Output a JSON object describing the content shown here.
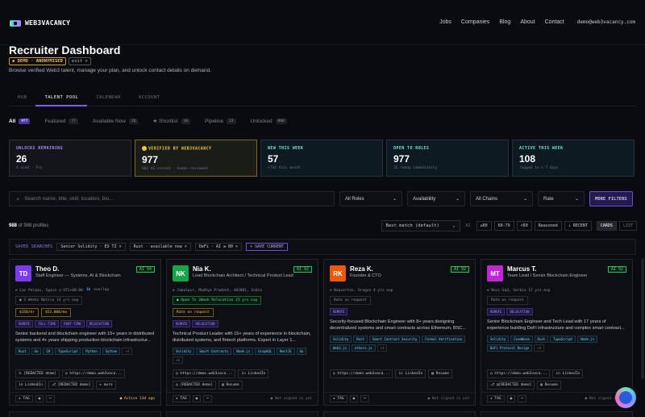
{
  "nav": {
    "brand": "WEB3VACANCY",
    "links": [
      "Jobs",
      "Companies",
      "Blog",
      "About",
      "Contact"
    ],
    "email": "demo@web3vacancy.com"
  },
  "page": {
    "title": "Recruiter Dashboard",
    "demo": "◆ DEMO · ANONYMISED",
    "exit": "exit ×",
    "subtitle": "Browse verified Web3 talent, manage your plan, and unlock contact details on demand."
  },
  "tabs": [
    "HUB",
    "TALENT POOL",
    "CALENDAR",
    "ACCOUNT"
  ],
  "subtabs": [
    {
      "label": "All",
      "count": "977"
    },
    {
      "label": "Featured",
      "count": "77"
    },
    {
      "label": "Available Now",
      "count": "26"
    },
    {
      "label": "★ Shortlist",
      "count": "10"
    },
    {
      "label": "Pipeline",
      "count": "13"
    },
    {
      "label": "Unlocked",
      "count": "000"
    }
  ],
  "stats": [
    {
      "label": "UNLOCKS REMAINING",
      "value": "26",
      "sub": "4 used · Pro"
    },
    {
      "label": "VERIFIED BY WEB3VACANCY",
      "value": "977",
      "sub": "802 AI-scored · human-reviewed"
    },
    {
      "label": "NEW THIS WEEK",
      "value": "57",
      "sub": "+744 this month"
    },
    {
      "label": "OPEN TO ROLES",
      "value": "977",
      "sub": "26 ready immediately"
    },
    {
      "label": "ACTIVE THIS WEEK",
      "value": "108",
      "sub": "logged in < 7 days"
    }
  ],
  "filters": {
    "search_placeholder": "Search name, title, skill, location, bio...",
    "roles": "All Roles",
    "availability": "Availability",
    "chains": "All Chains",
    "rate": "Rate",
    "more": "MORE FILTERS"
  },
  "results": {
    "count": "988",
    "total": "of 988 profiles"
  },
  "sort": {
    "value": "Best match (default)",
    "chips": [
      "AI",
      "≥80",
      "60-79",
      "<60",
      "Reasoned",
      "↓ RECENT"
    ],
    "views": [
      "CARDS",
      "LIST"
    ]
  },
  "saved": {
    "label": "SAVED SEARCHES",
    "chips": [
      "Senior Solidity · EU TZ ×",
      "Rust · available now ×",
      "DeFi · AI ≥ 80 ×"
    ],
    "save": "+ SAVE CURRENT"
  },
  "cards": [
    {
      "initials": "TD",
      "color": "#7c3aed",
      "name": "Theo D.",
      "role": "Staff Engineer — Systems, AI & Blockchain",
      "ai": "AI 94",
      "loc": "⌖ Las Palmas, Spain  ◷ UTC+00:00",
      "overlap": "1h",
      "overlap_text": "overlap",
      "notice": "● 2 Weeks Notice  14 yrs exp",
      "notice_green": false,
      "rates": [
        "$150/hr",
        "$53,000/mo"
      ],
      "badges": [
        "REMOTE",
        "FULL-TIME",
        "PART-TIME",
        "RELOCATION"
      ],
      "bio": "Senior backend and blockchain engineer with 15+ years in distributed systems and 4+ years shipping production blockchain infrastructur...",
      "skills": [
        "Rust",
        "Go",
        "C#",
        "TypeScript",
        "Python",
        "Sython",
        "+4"
      ],
      "links": [
        "𝕏 [REDACTED demo]",
        "◎ https://demo.web3vaca...",
        "in LinkedIn",
        "⎇ [REDACTED demo]",
        "+ more"
      ],
      "foot": [
        "★ TAG",
        "◉",
        "⋯"
      ],
      "status": "● Active 13d ago",
      "active": true
    },
    {
      "initials": "NK",
      "color": "#16a34a",
      "name": "Nia K.",
      "role": "Lead Blockchain Architect / Technical Product Lead",
      "ai": "AI 92",
      "loc": "⌖ Jabalpur, Madhya Pradesh, 482001, India",
      "overlap": "",
      "overlap_text": "",
      "notice": "● Open To 2Week Relocation  23 yrs exp",
      "notice_green": true,
      "rates": [
        "Rate on request"
      ],
      "badges": [
        "REMOTE",
        "RELOCATION"
      ],
      "bio": "Technical Product Leader with 15+ years of experience in blockchain, distributed systems, and fintech platforms. Expert in Layer 1...",
      "skills": [
        "Solidity",
        "Smart Contracts",
        "Node.js",
        "GraphQL",
        "NestJS",
        "Go",
        "+4"
      ],
      "links": [
        "◎ https://demo.web3vaca...",
        "in LinkedIn",
        "◎ [REDACTED demo]",
        "▤ Resume"
      ],
      "foot": [
        "★ TAG",
        "◉",
        "⋯"
      ],
      "status": "● Not signed in yet",
      "active": false
    },
    {
      "initials": "RK",
      "color": "#ea580c",
      "name": "Reza K.",
      "role": "Founder & CTO",
      "ai": "AI 92",
      "loc": "⌖ Beaverton, Oregon  4 yrs exp",
      "overlap": "",
      "overlap_text": "",
      "notice": "Rate on request",
      "notice_green": false,
      "rates": [],
      "badges": [
        "REMOTE"
      ],
      "bio": "Security-focused Blockchain Engineer with 8+ years designing decentralized systems and smart contracts across Ethereum, BSC...",
      "skills": [
        "Solidity",
        "Rust",
        "Smart Contract Security",
        "Formal Verification",
        "Web3.js",
        "ethers.js",
        "+4"
      ],
      "links": [
        "◎ https://demo.web3vaca...",
        "in LinkedIn",
        "▤ Resume"
      ],
      "foot": [
        "★ TAG",
        "◉",
        "⋯"
      ],
      "status": "● Not signed in yet",
      "active": false
    },
    {
      "initials": "MT",
      "color": "#c026d3",
      "name": "Marcus T.",
      "role": "Team Lead / Senior Blockchain Engineer",
      "ai": "AI 92",
      "loc": "⌖ Novi-Sad, Serbia  17 yrs exp",
      "overlap": "",
      "overlap_text": "",
      "notice": "Rate on request",
      "notice_green": false,
      "rates": [],
      "badges": [
        "REMOTE",
        "RELOCATION"
      ],
      "bio": "Senior Blockchain Engineer and Tech Lead with 17 years of experience building DeFi infrastructure and complex smart contract...",
      "skills": [
        "Solidity",
        "CosmWasm",
        "Rust",
        "TypeScript",
        "Node.js",
        "DeFi Protocol Design",
        "+4"
      ],
      "links": [
        "◎ https://demo.web3vaca...",
        "in LinkedIn",
        "⎇ @[REDACTED demo]",
        "▤ Resume"
      ],
      "foot": [
        "★ TAG",
        "◉",
        "⋯"
      ],
      "status": "● Not signed in yet",
      "active": false
    }
  ]
}
